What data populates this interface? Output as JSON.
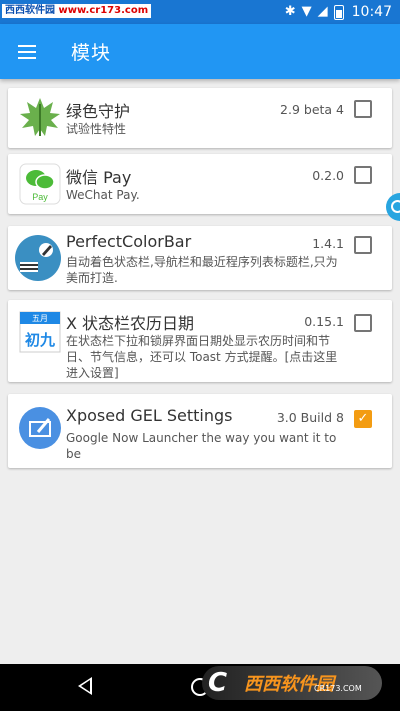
{
  "status_bar": {
    "watermark_site": "西西软件园",
    "watermark_url": "www.cr173.com",
    "time": "10:47"
  },
  "app_bar": {
    "title": "模块",
    "menu_icon": "menu-icon"
  },
  "modules": [
    {
      "icon": "leaf-icon",
      "title": "绿色守护",
      "desc": "试验性特性",
      "version": "2.9 beta 4",
      "enabled": false
    },
    {
      "icon": "wechat-pay-icon",
      "title": "微信 Pay",
      "desc": "WeChat Pay.",
      "version": "0.2.0",
      "enabled": false
    },
    {
      "icon": "colorbar-icon",
      "title": "PerfectColorBar",
      "desc": "自动着色状态栏,导航栏和最近程序列表标题栏,只为美而打造.",
      "version": "1.4.1",
      "enabled": false
    },
    {
      "icon": "calendar-icon",
      "title": "X 状态栏农历日期",
      "desc": "在状态栏下拉和锁屏界面日期处显示农历时间和节日、节气信息，还可以 Toast 方式提醒。[点击这里进入设置]",
      "version": "0.15.1",
      "enabled": false
    },
    {
      "icon": "gel-settings-icon",
      "title": "Xposed GEL Settings",
      "desc": "Google Now Launcher the way you want it to be",
      "version": "3.0 Build 8",
      "enabled": true
    }
  ],
  "calendar_icon": {
    "month": "五月",
    "day": "初九"
  },
  "wechat_icon": {
    "label": "Pay"
  },
  "watermark_bottom": {
    "letter": "C",
    "brand": "西西软件园",
    "url": "CR173.COM"
  },
  "colors": {
    "primary": "#2196f3",
    "primary_dark": "#1976d2",
    "checked": "#f39c12"
  }
}
